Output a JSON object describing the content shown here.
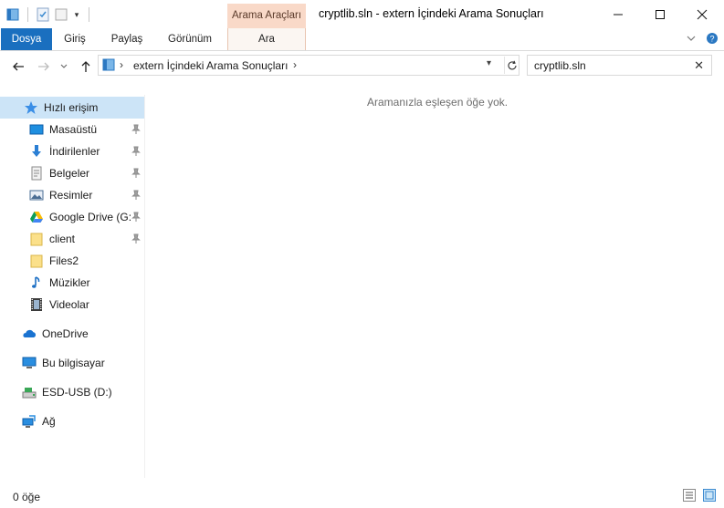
{
  "window": {
    "title": "cryptlib.sln - extern İçindeki Arama Sonuçları",
    "context_tab_header": "Arama Araçları"
  },
  "ribbon": {
    "tabs": [
      {
        "label": "Dosya"
      },
      {
        "label": "Giriş"
      },
      {
        "label": "Paylaş"
      },
      {
        "label": "Görünüm"
      },
      {
        "label": "Ara"
      }
    ]
  },
  "address": {
    "path": "extern İçindeki Arama Sonuçları"
  },
  "search": {
    "value": "cryptlib.sln"
  },
  "nav": {
    "quick_access": "Hızlı erişim",
    "items": [
      {
        "label": "Masaüstü",
        "icon": "desktop-icon",
        "pinned": true
      },
      {
        "label": "İndirilenler",
        "icon": "download-icon",
        "pinned": true
      },
      {
        "label": "Belgeler",
        "icon": "documents-icon",
        "pinned": true
      },
      {
        "label": "Resimler",
        "icon": "pictures-icon",
        "pinned": true
      },
      {
        "label": "Google Drive (G:",
        "icon": "google-drive-icon",
        "pinned": true
      },
      {
        "label": "client",
        "icon": "folder-icon",
        "pinned": true
      },
      {
        "label": "Files2",
        "icon": "folder-icon",
        "pinned": false
      },
      {
        "label": "Müzikler",
        "icon": "music-icon",
        "pinned": false
      },
      {
        "label": "Videolar",
        "icon": "videos-icon",
        "pinned": false
      }
    ],
    "onedrive": "OneDrive",
    "this_pc": "Bu bilgisayar",
    "usb": "ESD-USB (D:)",
    "network": "Ağ"
  },
  "content": {
    "empty_message": "Aramanızla eşleşen öğe yok."
  },
  "status": {
    "item_count": "0 öğe"
  },
  "colors": {
    "accent": "#1a6fbf",
    "selection": "#cce4f7",
    "context_tab": "#f9d9c8"
  }
}
